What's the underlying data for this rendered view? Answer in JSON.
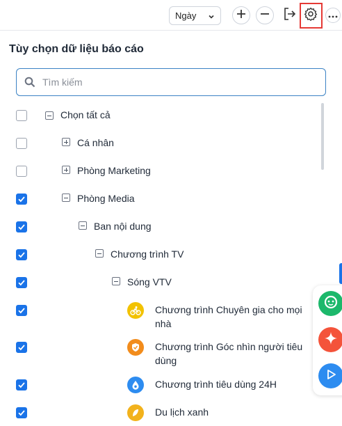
{
  "toolbar": {
    "period_select": "Ngày",
    "zoom_in_icon": "plus-icon",
    "zoom_out_icon": "minus-icon",
    "export_icon": "export-icon",
    "settings_icon": "gear-icon",
    "more_icon": "more-icon",
    "highlight_color": "#e53935"
  },
  "panel": {
    "title": "Tùy chọn dữ liệu báo cáo",
    "search_placeholder": "Tìm kiếm",
    "search_value": ""
  },
  "tree": [
    {
      "label": "Chọn tất cả",
      "checked": false,
      "toggle": "minus"
    },
    {
      "label": "Cá nhân",
      "checked": false,
      "toggle": "plus"
    },
    {
      "label": "Phòng Marketing",
      "checked": false,
      "toggle": "plus"
    },
    {
      "label": "Phòng Media",
      "checked": true,
      "toggle": "minus"
    },
    {
      "label": "Ban nội dung",
      "checked": true,
      "toggle": "minus"
    },
    {
      "label": "Chương trình TV",
      "checked": true,
      "toggle": "minus"
    },
    {
      "label": "Sóng VTV",
      "checked": true,
      "toggle": "minus"
    },
    {
      "label_line1": "Chương trình Chuyên gia cho mọi",
      "label_line2": "nhà",
      "checked": true,
      "icon": "bike-icon",
      "icon_color": "#f2c200"
    },
    {
      "label_line1": "Chương trình Góc nhìn người tiêu",
      "label_line2": "dùng",
      "checked": true,
      "icon": "shield-icon",
      "icon_color": "#f28c1c"
    },
    {
      "label": "Chương trình tiêu dùng 24H",
      "checked": true,
      "icon": "drop-icon",
      "icon_color": "#2d8cf0"
    },
    {
      "label": "Du lịch xanh",
      "checked": true,
      "icon": "leaf-icon",
      "icon_color": "#f2b21c"
    }
  ],
  "floating": {
    "chat_icon": "chat-icon",
    "chat_color": "#1cb86b",
    "ai_icon": "sparkle-icon",
    "ai_color": "#f4533a",
    "play_icon": "play-icon",
    "play_color": "#2d8cf0",
    "accent": "#1a73e8"
  }
}
